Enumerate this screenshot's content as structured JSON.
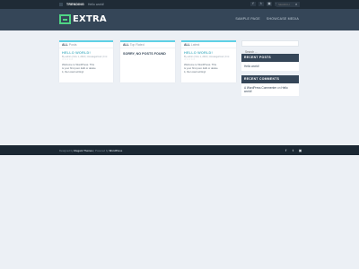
{
  "topbar": {
    "trending_label": "TRENDING",
    "trending_title": "Hello world!",
    "social": [
      "f",
      "t",
      "▣",
      "⊕"
    ],
    "search_placeholder": "SEARCH",
    "search_icon": "⌕"
  },
  "header": {
    "logo_text": "EXTRA",
    "nav": [
      "SAMPLE PAGE",
      "SHOWCASE MEDIA"
    ]
  },
  "cards": [
    {
      "head_strong": "ALL",
      "head_rest": " Posts",
      "title": "HELLO WORLD!",
      "meta": "By admin | Nov 1, 2016 | Uncategorized | 0 ✉",
      "stars": "☆☆☆☆☆",
      "excerpt": "Welcome to WordPress. This is your first post. Edit or delete it, then start writing!"
    },
    {
      "head_strong": "ALL",
      "head_rest": " Top Rated",
      "title": "SORRY, NO POSTS FOUND"
    },
    {
      "head_strong": "ALL",
      "head_rest": " Latest",
      "title": "HELLO WORLD!",
      "meta": "By admin | Nov 1, 2016 | Uncategorized | 0 ✉",
      "stars": "☆☆☆☆☆",
      "excerpt": "Welcome to WordPress. This is your first post. Edit or delete it, then start writing!"
    }
  ],
  "sidebar": {
    "search_placeholder": "Search ...",
    "recent_posts_title": "RECENT POSTS",
    "recent_posts": [
      "Hello world!"
    ],
    "recent_comments_title": "RECENT COMMENTS",
    "comment_author": "A WordPress Commenter",
    "comment_on": " on ",
    "comment_post": "Hello world!"
  },
  "footer": {
    "credit_prefix": "Designed by ",
    "credit_theme": "Elegant Themes",
    "credit_mid": " | Powered by ",
    "credit_wp": "WordPress",
    "social": [
      "f",
      "t",
      "▣"
    ]
  }
}
